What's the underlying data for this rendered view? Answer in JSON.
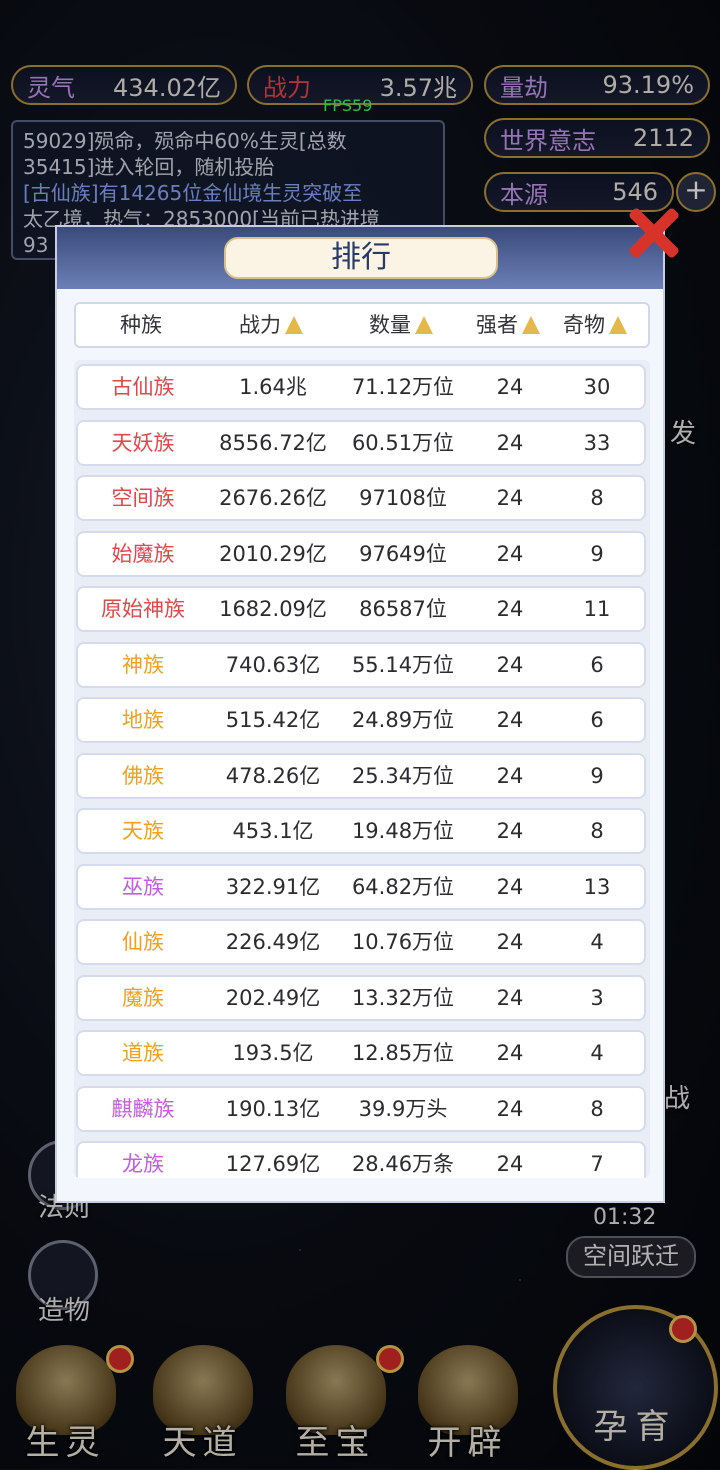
{
  "hud": {
    "lingqi_label": "灵气",
    "lingqi_value": "434.02亿",
    "zhanli_label": "战力",
    "zhanli_value": "3.57兆",
    "liangjie_label": "量劫",
    "liangjie_value": "93.19%",
    "world_will_label": "世界意志",
    "world_will_value": "2112",
    "benyuan_label": "本源",
    "benyuan_value": "546",
    "fps": "FPS59"
  },
  "log": {
    "line1": "59029]殒命，殒命中60%生灵[总数",
    "line2": "35415]进入轮回，随机投胎",
    "line3": "[古仙族]有14265位金仙境生灵突破至",
    "line4": "太乙境，热气：2853000[当前已热进境",
    "line5": "93"
  },
  "side": {
    "label_fa_ze": "法则",
    "label_zao_wu": "造物",
    "timer": "01:32",
    "space_jump": "空间跃迁",
    "label_fa": "发",
    "label_zhan": "战"
  },
  "nav": {
    "sheng_ling": "生灵",
    "tian_dao": "天道",
    "zhi_bao": "至宝",
    "kai_pi": "开辟",
    "yun_yu": "孕育"
  },
  "panel": {
    "title": "排行",
    "headers": {
      "race": "种族",
      "power": "战力",
      "count": "数量",
      "strong": "强者",
      "treasure": "奇物"
    },
    "rows": [
      {
        "race": "古仙族",
        "power": "1.64兆",
        "count": "71.12万位",
        "strong": "24",
        "treasure": "30"
      },
      {
        "race": "天妖族",
        "power": "8556.72亿",
        "count": "60.51万位",
        "strong": "24",
        "treasure": "33"
      },
      {
        "race": "空间族",
        "power": "2676.26亿",
        "count": "97108位",
        "strong": "24",
        "treasure": "8"
      },
      {
        "race": "始魔族",
        "power": "2010.29亿",
        "count": "97649位",
        "strong": "24",
        "treasure": "9"
      },
      {
        "race": "原始神族",
        "power": "1682.09亿",
        "count": "86587位",
        "strong": "24",
        "treasure": "11"
      },
      {
        "race": "神族",
        "power": "740.63亿",
        "count": "55.14万位",
        "strong": "24",
        "treasure": "6"
      },
      {
        "race": "地族",
        "power": "515.42亿",
        "count": "24.89万位",
        "strong": "24",
        "treasure": "6"
      },
      {
        "race": "佛族",
        "power": "478.26亿",
        "count": "25.34万位",
        "strong": "24",
        "treasure": "9"
      },
      {
        "race": "天族",
        "power": "453.1亿",
        "count": "19.48万位",
        "strong": "24",
        "treasure": "8"
      },
      {
        "race": "巫族",
        "power": "322.91亿",
        "count": "64.82万位",
        "strong": "24",
        "treasure": "13"
      },
      {
        "race": "仙族",
        "power": "226.49亿",
        "count": "10.76万位",
        "strong": "24",
        "treasure": "4"
      },
      {
        "race": "魔族",
        "power": "202.49亿",
        "count": "13.32万位",
        "strong": "24",
        "treasure": "3"
      },
      {
        "race": "道族",
        "power": "193.5亿",
        "count": "12.85万位",
        "strong": "24",
        "treasure": "4"
      },
      {
        "race": "麒麟族",
        "power": "190.13亿",
        "count": "39.9万头",
        "strong": "24",
        "treasure": "8"
      },
      {
        "race": "龙族",
        "power": "127.69亿",
        "count": "28.46万条",
        "strong": "24",
        "treasure": "7"
      }
    ]
  },
  "colors": {
    "red_race": "#e0474a",
    "orange_race": "#f0a11c",
    "purple_race": "#c55be0",
    "race_color_map": [
      "#e0474a",
      "#e0474a",
      "#e0474a",
      "#e0474a",
      "#e0474a",
      "#f0a11c",
      "#f0a11c",
      "#f0a11c",
      "#f0a11c",
      "#c55be0",
      "#f0a11c",
      "#f0a11c",
      "#f0a11c",
      "#c55be0",
      "#c55be0"
    ]
  }
}
